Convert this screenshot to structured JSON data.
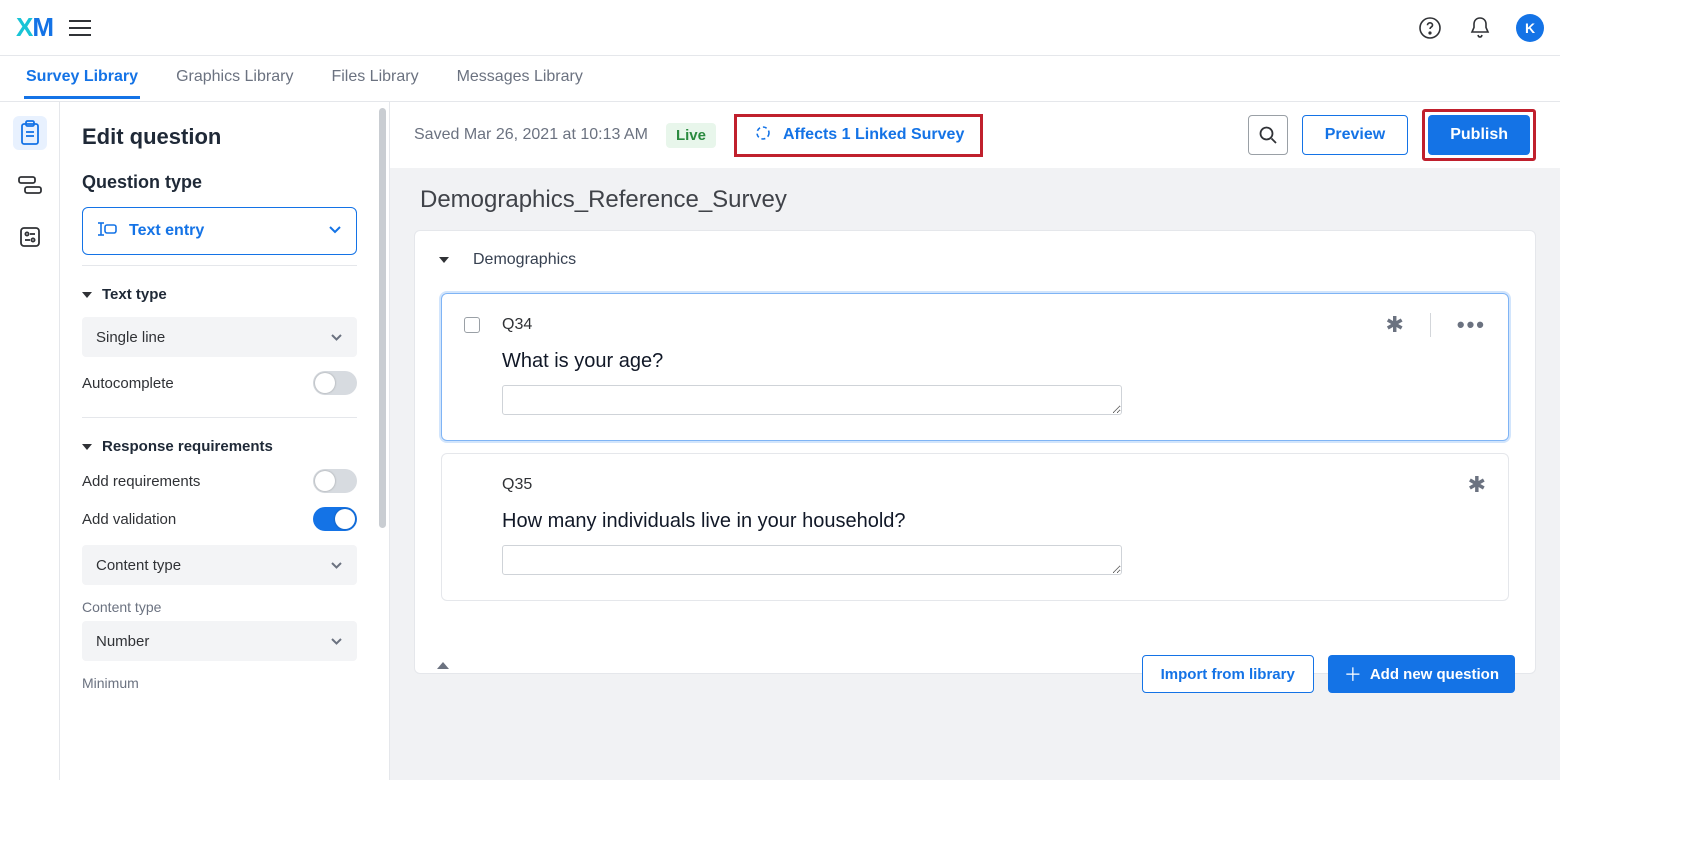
{
  "brand": {
    "x": "X",
    "m": "M"
  },
  "avatar_letter": "K",
  "tabs": [
    "Survey Library",
    "Graphics Library",
    "Files Library",
    "Messages Library"
  ],
  "panel": {
    "title": "Edit question",
    "question_type_heading": "Question type",
    "question_type_value": "Text entry",
    "text_type_heading": "Text type",
    "text_type_value": "Single line",
    "autocomplete_label": "Autocomplete",
    "autocomplete_on": false,
    "response_req_heading": "Response requirements",
    "add_requirements_label": "Add requirements",
    "add_requirements_on": false,
    "add_validation_label": "Add validation",
    "add_validation_on": true,
    "content_type_select_value": "Content type",
    "content_type_sublabel": "Content type",
    "number_select_value": "Number",
    "minimum_label": "Minimum"
  },
  "head": {
    "saved_text": "Saved Mar 26, 2021 at 10:13 AM",
    "live_label": "Live",
    "linked_label": "Affects 1 Linked Survey",
    "preview_label": "Preview",
    "publish_label": "Publish"
  },
  "survey": {
    "title": "Demographics_Reference_Survey",
    "block_name": "Demographics",
    "q1": {
      "id": "Q34",
      "text": "What is your age?"
    },
    "q2": {
      "id": "Q35",
      "text": "How many individuals live in your household?"
    },
    "import_label": "Import from library",
    "add_label": "Add new question"
  }
}
